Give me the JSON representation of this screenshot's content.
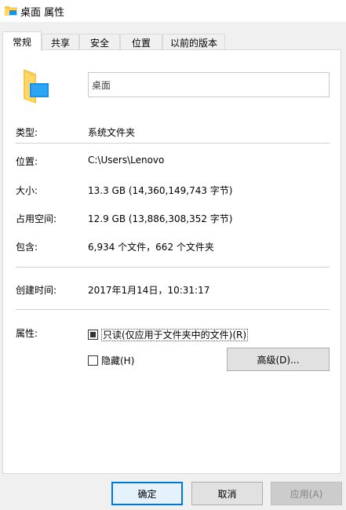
{
  "window": {
    "title": "桌面 属性",
    "icon": "folder-icon"
  },
  "tabs": [
    {
      "label": "常规",
      "active": true
    },
    {
      "label": "共享",
      "active": false
    },
    {
      "label": "安全",
      "active": false
    },
    {
      "label": "位置",
      "active": false
    },
    {
      "label": "以前的版本",
      "active": false
    }
  ],
  "general": {
    "name_value": "桌面",
    "type_label": "类型:",
    "type_value": "系统文件夹",
    "location_label": "位置:",
    "location_value": "C:\\Users\\Lenovo",
    "size_label": "大小:",
    "size_value": "13.3 GB (14,360,149,743 字节)",
    "disk_label": "占用空间:",
    "disk_value": "12.9 GB (13,886,308,352 字节)",
    "contains_label": "包含:",
    "contains_value": "6,934 个文件，662 个文件夹",
    "created_label": "创建时间:",
    "created_value": "2017年1月14日，10:31:17",
    "attributes_label": "属性:",
    "readonly_label": "只读(仅应用于文件夹中的文件)(R)",
    "readonly_state": "indeterminate",
    "hidden_label": "隐藏(H)",
    "hidden_checked": false,
    "advanced_label": "高级(D)..."
  },
  "buttons": {
    "ok": "确定",
    "cancel": "取消",
    "apply": "应用(A)"
  },
  "colors": {
    "accent": "#0078d7",
    "folder": "#f8c64e",
    "window_bg": "#f0f0f0"
  }
}
